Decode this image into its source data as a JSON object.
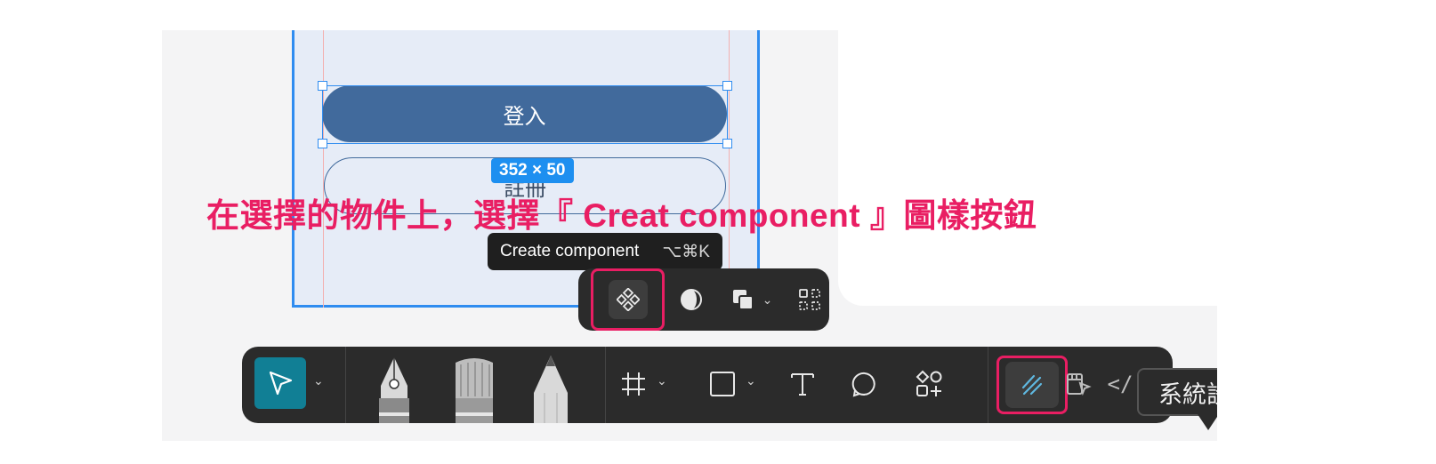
{
  "canvas": {
    "login_button": "登入",
    "register_button": "註冊",
    "size_badge": "352 × 50"
  },
  "annotation": {
    "text": "在選擇的物件上，選擇『 Creat component 』圖樣按鈕",
    "color": "#e91e63"
  },
  "tooltip": {
    "label": "Create component",
    "shortcut": "⌥⌘K"
  },
  "context_toolbar": {
    "items": [
      {
        "icon": "create-component-icon",
        "active": true
      },
      {
        "icon": "mask-icon"
      },
      {
        "icon": "boolean-groups-icon",
        "has_dropdown": true
      },
      {
        "icon": "use-as-mask-grid-icon"
      }
    ]
  },
  "main_toolbar": {
    "tools": [
      {
        "icon": "move-tool-icon",
        "active": true,
        "has_dropdown": true
      },
      {
        "icon": "pen-tool-icon"
      },
      {
        "icon": "brush-tool-icon"
      },
      {
        "icon": "pencil-tool-icon"
      },
      {
        "icon": "frame-tool-icon",
        "has_dropdown": true
      },
      {
        "icon": "rectangle-tool-icon",
        "has_dropdown": true
      },
      {
        "icon": "text-tool-icon"
      },
      {
        "icon": "comment-tool-icon"
      },
      {
        "icon": "actions-tool-icon"
      },
      {
        "icon": "draw-mode-icon",
        "highlighted": true
      },
      {
        "icon": "design-mode-icon"
      },
      {
        "icon": "dev-mode-icon"
      }
    ]
  },
  "system_tooltip": {
    "label": "系統設"
  },
  "colors": {
    "accent_blue": "#2f8cf0",
    "primary_button": "#416a9c",
    "toolbar_bg": "#2b2b2b",
    "move_tool_active": "#117f95",
    "highlight": "#e91e63"
  }
}
